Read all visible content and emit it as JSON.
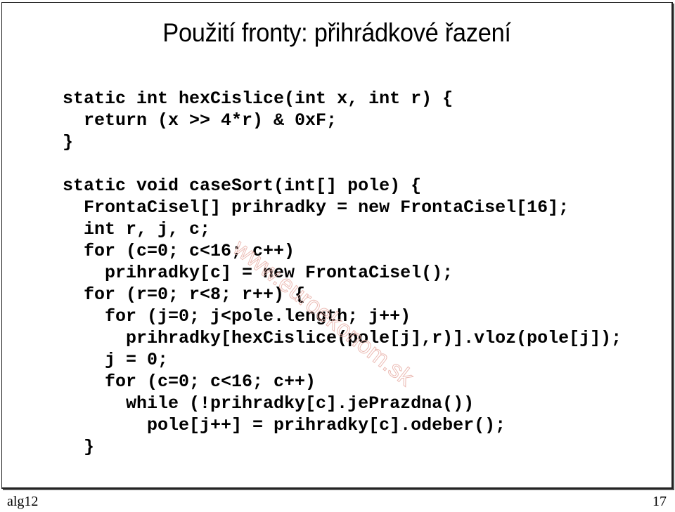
{
  "slide": {
    "title": "Použití fronty: přihrádkové řazení",
    "code_lines": [
      "static int hexCislice(int x, int r) {",
      "  return (x >> 4*r) & 0xF;",
      "}",
      "",
      "static void caseSort(int[] pole) {",
      "  FrontaCisel[] prihradky = new FrontaCisel[16];",
      "  int r, j, c;",
      "  for (c=0; c<16; c++)",
      "    prihradky[c] = new FrontaCisel();",
      "  for (r=0; r<8; r++) {",
      "    for (j=0; j<pole.length; j++)",
      "      prihradky[hexCislice(pole[j],r)].vloz(pole[j]);",
      "    j = 0;",
      "    for (c=0; c<16; c++)",
      "      while (!prihradky[c].jePrazdna())",
      "        pole[j++] = prihradky[c].odeber();",
      "  }"
    ],
    "watermark": "www.euroekonom.sk"
  },
  "footer": {
    "left": "alg12",
    "page_number": "17"
  }
}
